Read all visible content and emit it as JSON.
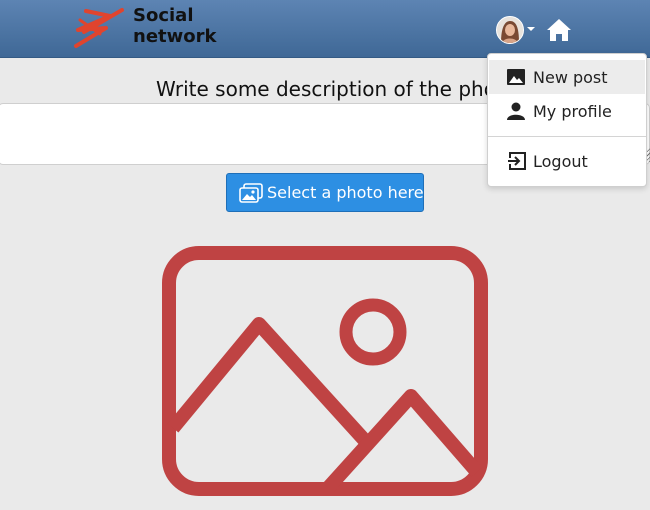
{
  "header": {
    "logo_line1": "Social",
    "logo_line2": "network",
    "brand_color": "#e0442e",
    "avatar": "user-avatar",
    "home_icon": "home-icon"
  },
  "post_form": {
    "description_label": "Write some description of the photo",
    "description_value": "",
    "select_button_label": "Select a photo here",
    "select_button_icon": "images-icon",
    "placeholder_icon": "image-placeholder-icon",
    "placeholder_color": "#bf4343"
  },
  "user_menu": {
    "items": [
      {
        "label": "New post",
        "icon": "image-icon",
        "active": true
      },
      {
        "label": "My profile",
        "icon": "person-icon",
        "active": false
      },
      {
        "label": "Logout",
        "icon": "logout-icon",
        "active": false
      }
    ]
  },
  "colors": {
    "navbar": "#4a73a3",
    "button": "#2d8fe3",
    "background": "#eaeaea"
  }
}
